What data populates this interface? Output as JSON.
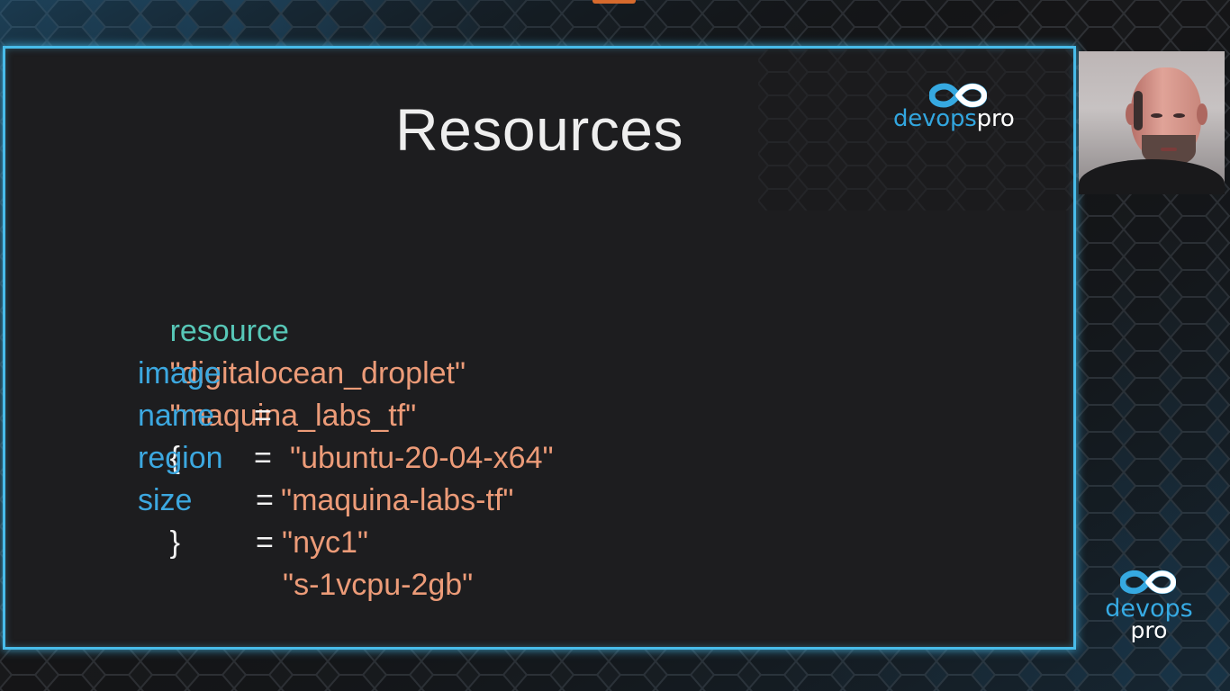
{
  "slide": {
    "title": "Resources",
    "code": {
      "line1": {
        "keyword": "resource",
        "type": "\"digitalocean_droplet\"",
        "name": "\"maquina_labs_tf\"",
        "brace": "{"
      },
      "fields": [
        {
          "name": "image",
          "equals": "=",
          "value": "\"ubuntu-20-04-x64\""
        },
        {
          "name": "name",
          "equals": "=",
          "value": "\"maquina-labs-tf\""
        },
        {
          "name": "region",
          "equals": "=",
          "value": "\"nyc1\""
        },
        {
          "name": "size",
          "equals": "=",
          "value": "\"s-1vcpu-2gb\""
        }
      ],
      "close_brace": "}"
    },
    "logo": {
      "devops": "devops",
      "pro": "pro",
      "icon": "infinity-icon"
    }
  },
  "corner_logo": {
    "devops": "devops",
    "pro": "pro",
    "icon": "infinity-icon"
  },
  "camera": {
    "icon": "presenter-webcam"
  },
  "colors": {
    "frame": "#48bcea",
    "keyword": "#57c7b7",
    "string": "#ec9b78",
    "field": "#3ca8e0",
    "brand_blue": "#32a6df"
  }
}
